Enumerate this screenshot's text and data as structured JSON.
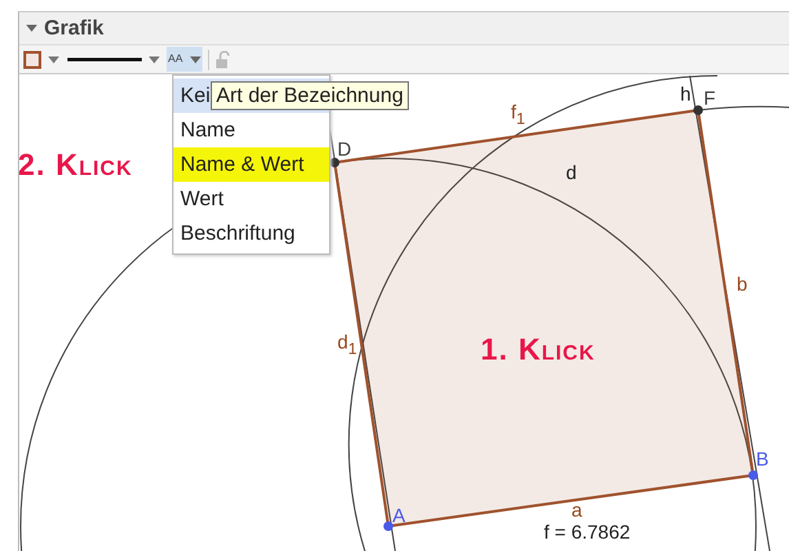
{
  "panel": {
    "title": "Grafik"
  },
  "toolbar": {
    "label_button_pressed": true,
    "lock_disabled": true,
    "label_icon_text": "AA"
  },
  "menu": {
    "items": [
      {
        "label": "Kei",
        "selected": true,
        "highlighted": false
      },
      {
        "label": "Name",
        "selected": false,
        "highlighted": false
      },
      {
        "label": "Name & Wert",
        "selected": false,
        "highlighted": true
      },
      {
        "label": "Wert",
        "selected": false,
        "highlighted": false
      },
      {
        "label": "Beschriftung",
        "selected": false,
        "highlighted": false
      }
    ]
  },
  "tooltip": "Art der Bezeichnung",
  "annotations": [
    "2. Klick",
    "1. Klick"
  ],
  "points": [
    {
      "name": "A",
      "kind": "free"
    },
    {
      "name": "B",
      "kind": "free"
    },
    {
      "name": "F",
      "kind": "dependent"
    },
    {
      "name": "D",
      "kind": "dependent"
    }
  ],
  "object_labels": [
    {
      "text": "f$_{1}$",
      "kind": "segment"
    },
    {
      "text": "d",
      "kind": "arc"
    },
    {
      "text": "h",
      "kind": "line"
    },
    {
      "text": "b",
      "kind": "segment"
    },
    {
      "text": "d$_{1}$",
      "kind": "segment"
    },
    {
      "text": "a",
      "kind": "segment"
    }
  ],
  "value_text": "f = 6.7862"
}
